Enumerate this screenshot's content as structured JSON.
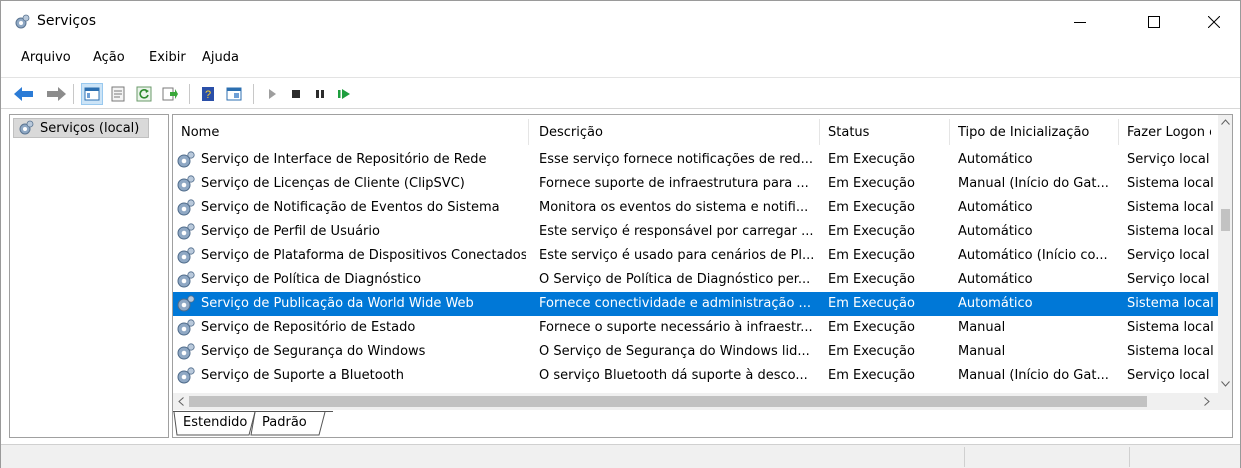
{
  "window": {
    "title": "Serviços",
    "controls": {
      "minimize": "minimize-icon",
      "maximize": "maximize-icon",
      "close": "close-icon"
    }
  },
  "menu": [
    {
      "label": "Arquivo"
    },
    {
      "label": "Ação"
    },
    {
      "label": "Exibir"
    },
    {
      "label": "Ajuda"
    }
  ],
  "toolbar": {
    "icons": [
      "back-arrow-icon",
      "forward-arrow-icon",
      "console-tree-icon",
      "properties-icon",
      "refresh-icon",
      "export-list-icon",
      "help-icon",
      "view-icon",
      "start-service-icon",
      "stop-service-icon",
      "pause-service-icon",
      "restart-service-icon"
    ]
  },
  "tree": {
    "root_label": "Serviços (local)"
  },
  "list": {
    "columns": [
      "Nome",
      "Descrição",
      "Status",
      "Tipo de Inicialização",
      "Fazer Logon como"
    ],
    "rows": [
      [
        "Serviço de Interface de Repositório de Rede",
        "Esse serviço fornece notificações de red...",
        "Em Execução",
        "Automático",
        "Serviço local"
      ],
      [
        "Serviço de Licenças de Cliente (ClipSVC)",
        "Fornece suporte de infraestrutura para ...",
        "Em Execução",
        "Manual (Início do Gat...",
        "Sistema local"
      ],
      [
        "Serviço de Notificação de Eventos do Sistema",
        "Monitora os eventos do sistema e notifi...",
        "Em Execução",
        "Automático",
        "Sistema local"
      ],
      [
        "Serviço de Perfil de Usuário",
        "Este serviço é responsável por carregar ...",
        "Em Execução",
        "Automático",
        "Sistema local"
      ],
      [
        "Serviço de Plataforma de Dispositivos Conectados",
        "Este serviço é usado para cenários de Pl...",
        "Em Execução",
        "Automático (Início co...",
        "Serviço local"
      ],
      [
        "Serviço de Política de Diagnóstico",
        "O Serviço de Política de Diagnóstico per...",
        "Em Execução",
        "Automático",
        "Serviço local"
      ],
      [
        "Serviço de Publicação da World Wide Web",
        "Fornece conectividade e administração ...",
        "Em Execução",
        "Automático",
        "Sistema local"
      ],
      [
        "Serviço de Repositório de Estado",
        "Fornece o suporte necessário à infraestr...",
        "Em Execução",
        "Manual",
        "Sistema local"
      ],
      [
        "Serviço de Segurança do Windows",
        "O Serviço de Segurança do Windows lid...",
        "Em Execução",
        "Manual",
        "Sistema local"
      ],
      [
        "Serviço de Suporte a Bluetooth",
        "O serviço Bluetooth dá suporte à desco...",
        "Em Execução",
        "Manual (Início do Gat...",
        "Serviço local"
      ]
    ],
    "selected_index": 6,
    "selection_color": "#0078d7"
  },
  "tabs": [
    {
      "label": "Estendido"
    },
    {
      "label": "Padrão"
    }
  ]
}
